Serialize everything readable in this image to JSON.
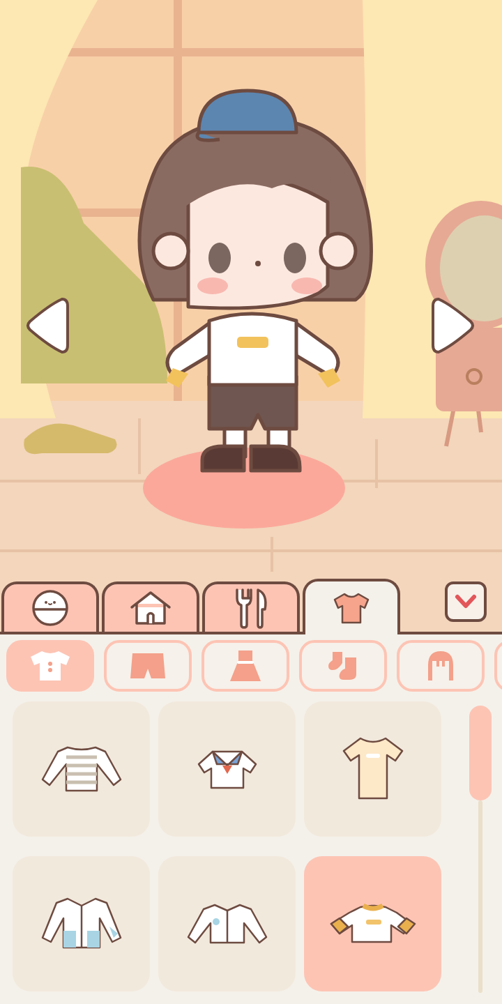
{
  "scene": {
    "nav_arrows": [
      {
        "kind": "previous"
      },
      {
        "kind": "next"
      }
    ]
  },
  "tabs": [
    {
      "kind": "face",
      "selected": false
    },
    {
      "kind": "home",
      "selected": false
    },
    {
      "kind": "food",
      "selected": false
    },
    {
      "kind": "clothes",
      "selected": true
    }
  ],
  "collapse_button": {
    "kind": "chevron-down"
  },
  "categories": [
    {
      "kind": "top",
      "selected": true
    },
    {
      "kind": "shorts",
      "selected": false
    },
    {
      "kind": "dress",
      "selected": false
    },
    {
      "kind": "socks",
      "selected": false
    },
    {
      "kind": "hair",
      "selected": false
    },
    {
      "kind": "partial",
      "selected": false
    }
  ],
  "items": [
    {
      "kind": "striped-sweater",
      "selected": false
    },
    {
      "kind": "sailor-top",
      "selected": false
    },
    {
      "kind": "tshirt",
      "selected": false
    },
    {
      "kind": "open-shirt",
      "selected": false
    },
    {
      "kind": "white-shirt",
      "selected": false
    },
    {
      "kind": "ringer-tshirt",
      "selected": true
    }
  ]
}
